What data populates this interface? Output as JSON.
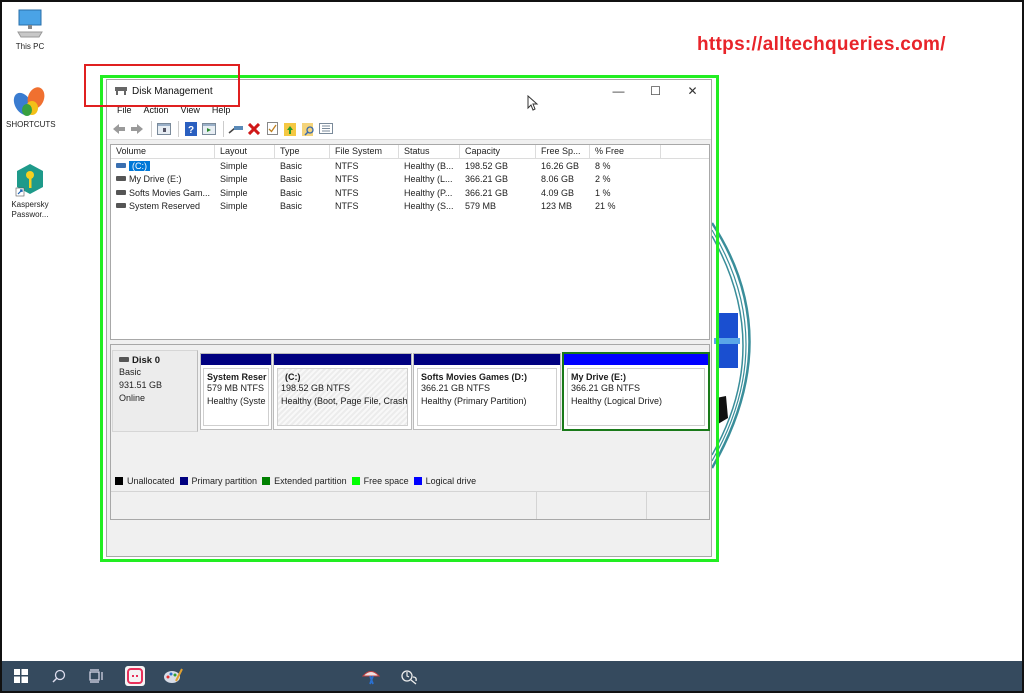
{
  "desktop": {
    "icons": [
      {
        "name": "this-pc",
        "label": "This PC"
      },
      {
        "name": "shortcuts",
        "label": "SHORTCUTS"
      },
      {
        "name": "kaspersky",
        "label": "Kaspersky Passwor..."
      }
    ],
    "watermark": "https://alltechqueries.com/"
  },
  "window": {
    "title": "Disk Management",
    "controls": {
      "minimize": "—",
      "maximize": "☐",
      "close": "✕"
    },
    "menu": [
      "File",
      "Action",
      "View",
      "Help"
    ],
    "toolbar": [
      "back-icon",
      "forward-icon",
      "console-tree-icon",
      "help-icon",
      "properties-pane-icon",
      "connect-icon",
      "delete-icon",
      "check-icon",
      "folder-up-icon",
      "folder-search-icon",
      "list-view-icon"
    ]
  },
  "volume_list": {
    "columns": [
      "Volume",
      "Layout",
      "Type",
      "File System",
      "Status",
      "Capacity",
      "Free Sp...",
      "% Free"
    ],
    "rows": [
      {
        "volume": "(C:)",
        "layout": "Simple",
        "type": "Basic",
        "fs": "NTFS",
        "status": "Healthy (B...",
        "capacity": "198.52 GB",
        "free": "16.26 GB",
        "pct": "8 %",
        "selected": true
      },
      {
        "volume": "My Drive (E:)",
        "layout": "Simple",
        "type": "Basic",
        "fs": "NTFS",
        "status": "Healthy (L...",
        "capacity": "366.21 GB",
        "free": "8.06 GB",
        "pct": "2 %"
      },
      {
        "volume": "Softs Movies Gam...",
        "layout": "Simple",
        "type": "Basic",
        "fs": "NTFS",
        "status": "Healthy (P...",
        "capacity": "366.21 GB",
        "free": "4.09 GB",
        "pct": "1 %"
      },
      {
        "volume": "System Reserved",
        "layout": "Simple",
        "type": "Basic",
        "fs": "NTFS",
        "status": "Healthy (S...",
        "capacity": "579 MB",
        "free": "123 MB",
        "pct": "21 %"
      }
    ]
  },
  "disk": {
    "name": "Disk 0",
    "type": "Basic",
    "size": "931.51 GB",
    "state": "Online",
    "partitions": [
      {
        "name": "System Reser",
        "size": "579 MB NTFS",
        "status": "Healthy (Syste"
      },
      {
        "name": "(C:)",
        "size": "198.52 GB NTFS",
        "status": "Healthy (Boot, Page File, Crash"
      },
      {
        "name": "Softs Movies Games  (D:)",
        "size": "366.21 GB NTFS",
        "status": "Healthy (Primary Partition)"
      },
      {
        "name": "My Drive  (E:)",
        "size": "366.21 GB NTFS",
        "status": "Healthy (Logical Drive)"
      }
    ]
  },
  "legend": [
    {
      "label": "Unallocated",
      "color": "#000000"
    },
    {
      "label": "Primary partition",
      "color": "#000080"
    },
    {
      "label": "Extended partition",
      "color": "#008000"
    },
    {
      "label": "Free space",
      "color": "#00ff00"
    },
    {
      "label": "Logical drive",
      "color": "#0000ff"
    }
  ],
  "colors": {
    "highlight_green": "#22ee22",
    "highlight_red": "#e02020",
    "taskbar": "#354a5e",
    "selection": "#0078d7"
  },
  "taskbar": [
    "start-icon",
    "search-icon",
    "task-view-icon",
    "app-pink-icon",
    "paint-icon",
    "snipping-icon",
    "tools-icon"
  ]
}
